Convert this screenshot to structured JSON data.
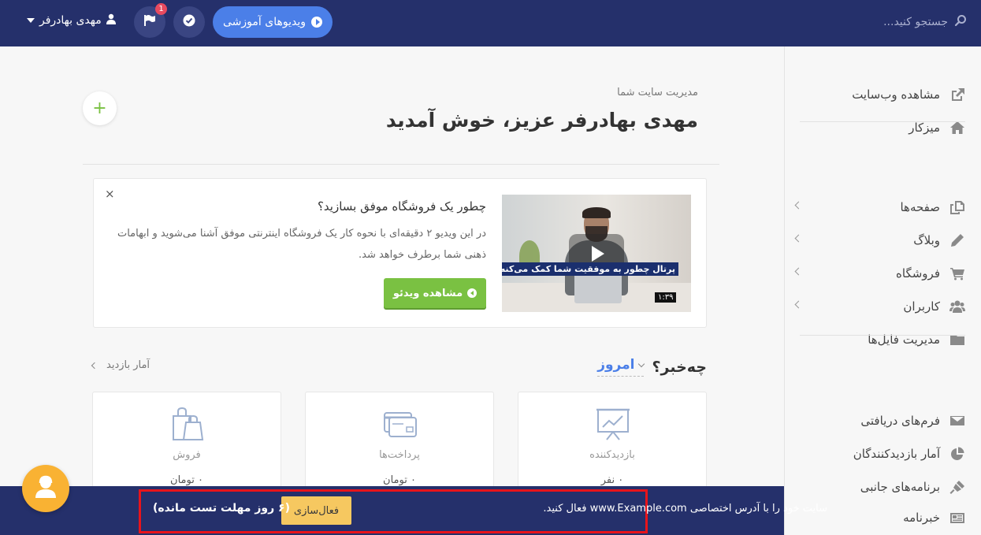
{
  "topbar": {
    "search_placeholder": "جستجو کنید...",
    "user_name": "مهدی بهادرفر",
    "notification_count": "1",
    "videos_button": "ویدیوهای آموزشی",
    "background_color": "#25306b",
    "accent_color": "#4b7fe8"
  },
  "sidebar": {
    "group1": [
      {
        "label": "مشاهده وب‌سایت",
        "icon": "external-link-icon"
      },
      {
        "label": "میزکار",
        "icon": "home-icon"
      }
    ],
    "group2": [
      {
        "label": "صفحه‌ها",
        "icon": "pages-icon"
      },
      {
        "label": "وبلاگ",
        "icon": "pencil-icon"
      },
      {
        "label": "فروشگاه",
        "icon": "cart-icon"
      },
      {
        "label": "کاربران",
        "icon": "users-icon"
      },
      {
        "label": "مدیریت فایل‌ها",
        "icon": "folder-icon"
      }
    ],
    "group3": [
      {
        "label": "فرم‌های دریافتی",
        "icon": "envelope-icon"
      },
      {
        "label": "آمار بازدیدکنندگان",
        "icon": "pie-chart-icon"
      },
      {
        "label": "برنامه‌های جانبی",
        "icon": "plugin-icon"
      },
      {
        "label": "خبرنامه",
        "icon": "newspaper-icon"
      }
    ]
  },
  "header": {
    "breadcrumb": "مدیریت سایت شما",
    "title": "مهدی بهادرفر عزیز، خوش آمدید",
    "add_label": "+"
  },
  "promo": {
    "close": "×",
    "title": "چطور یک فروشگاه موفق بسازید؟",
    "description": "در این ویدیو ۲ دقیقه‌ای با نحوه کار یک فروشگاه اینترنتی موفق آشنا می‌شوید و ابهامات ذهنی شما برطرف خواهد شد.",
    "button": "مشاهده ویدئو",
    "video_caption": "پرتال چطور به موفقیت شما کمک می‌کنه؟",
    "video_duration": "۱:۳۹",
    "button_color": "#7ac142"
  },
  "stats": {
    "heading": "چه‌خبر؟",
    "period": "امروز",
    "link": "آمار بازدید",
    "cards": [
      {
        "label": "بازدیدکننده",
        "value": "۰ نفر",
        "icon": "presentation-chart-icon"
      },
      {
        "label": "پرداخت‌ها",
        "value": "۰ تومان",
        "icon": "credit-card-icon"
      },
      {
        "label": "فروش",
        "value": "۰ تومان",
        "icon": "shopping-bags-icon"
      }
    ]
  },
  "banner": {
    "text": "سایت خود را با آدرس اختصاصی www.Example.com فعال کنید.",
    "button": "فعال‌سازی",
    "trial": "(۶ روز مهلت تست مانده)",
    "highlight_color": "#e8141b",
    "button_color": "#f6c860"
  }
}
